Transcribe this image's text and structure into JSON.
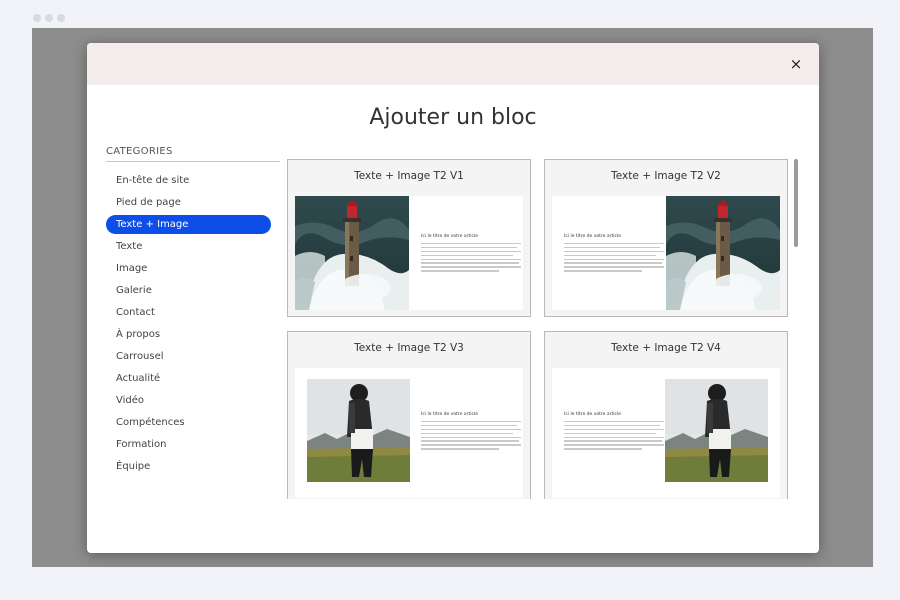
{
  "modal": {
    "title": "Ajouter un bloc",
    "close_label": "×"
  },
  "categories": {
    "title": "CATEGORIES",
    "items": [
      {
        "label": "En-tête de site"
      },
      {
        "label": "Pied de page"
      },
      {
        "label": "Texte + Image",
        "active": true
      },
      {
        "label": "Texte"
      },
      {
        "label": "Image"
      },
      {
        "label": "Galerie"
      },
      {
        "label": "Contact"
      },
      {
        "label": "À propos"
      },
      {
        "label": "Carrousel"
      },
      {
        "label": "Actualité"
      },
      {
        "label": "Vidéo"
      },
      {
        "label": "Compétences"
      },
      {
        "label": "Formation"
      },
      {
        "label": "Équipe"
      }
    ]
  },
  "blocks": [
    {
      "title": "Texte + Image T2 V1",
      "image": "lighthouse-image",
      "image_side": "left",
      "heading": "Ici le titre de votre article"
    },
    {
      "title": "Texte + Image T2 V2",
      "image": "lighthouse-image",
      "image_side": "right",
      "heading": "Ici le titre de votre article"
    },
    {
      "title": "Texte + Image T2 V3",
      "image": "person-walking-image",
      "image_side": "left",
      "heading": "Ici le titre de votre article"
    },
    {
      "title": "Texte + Image T2 V4",
      "image": "person-walking-image",
      "image_side": "right",
      "heading": "Ici le titre de votre article"
    }
  ],
  "colors": {
    "accent": "#0d4de8",
    "modal_header": "#f3eceb",
    "overlay": "#8d8d8d"
  }
}
